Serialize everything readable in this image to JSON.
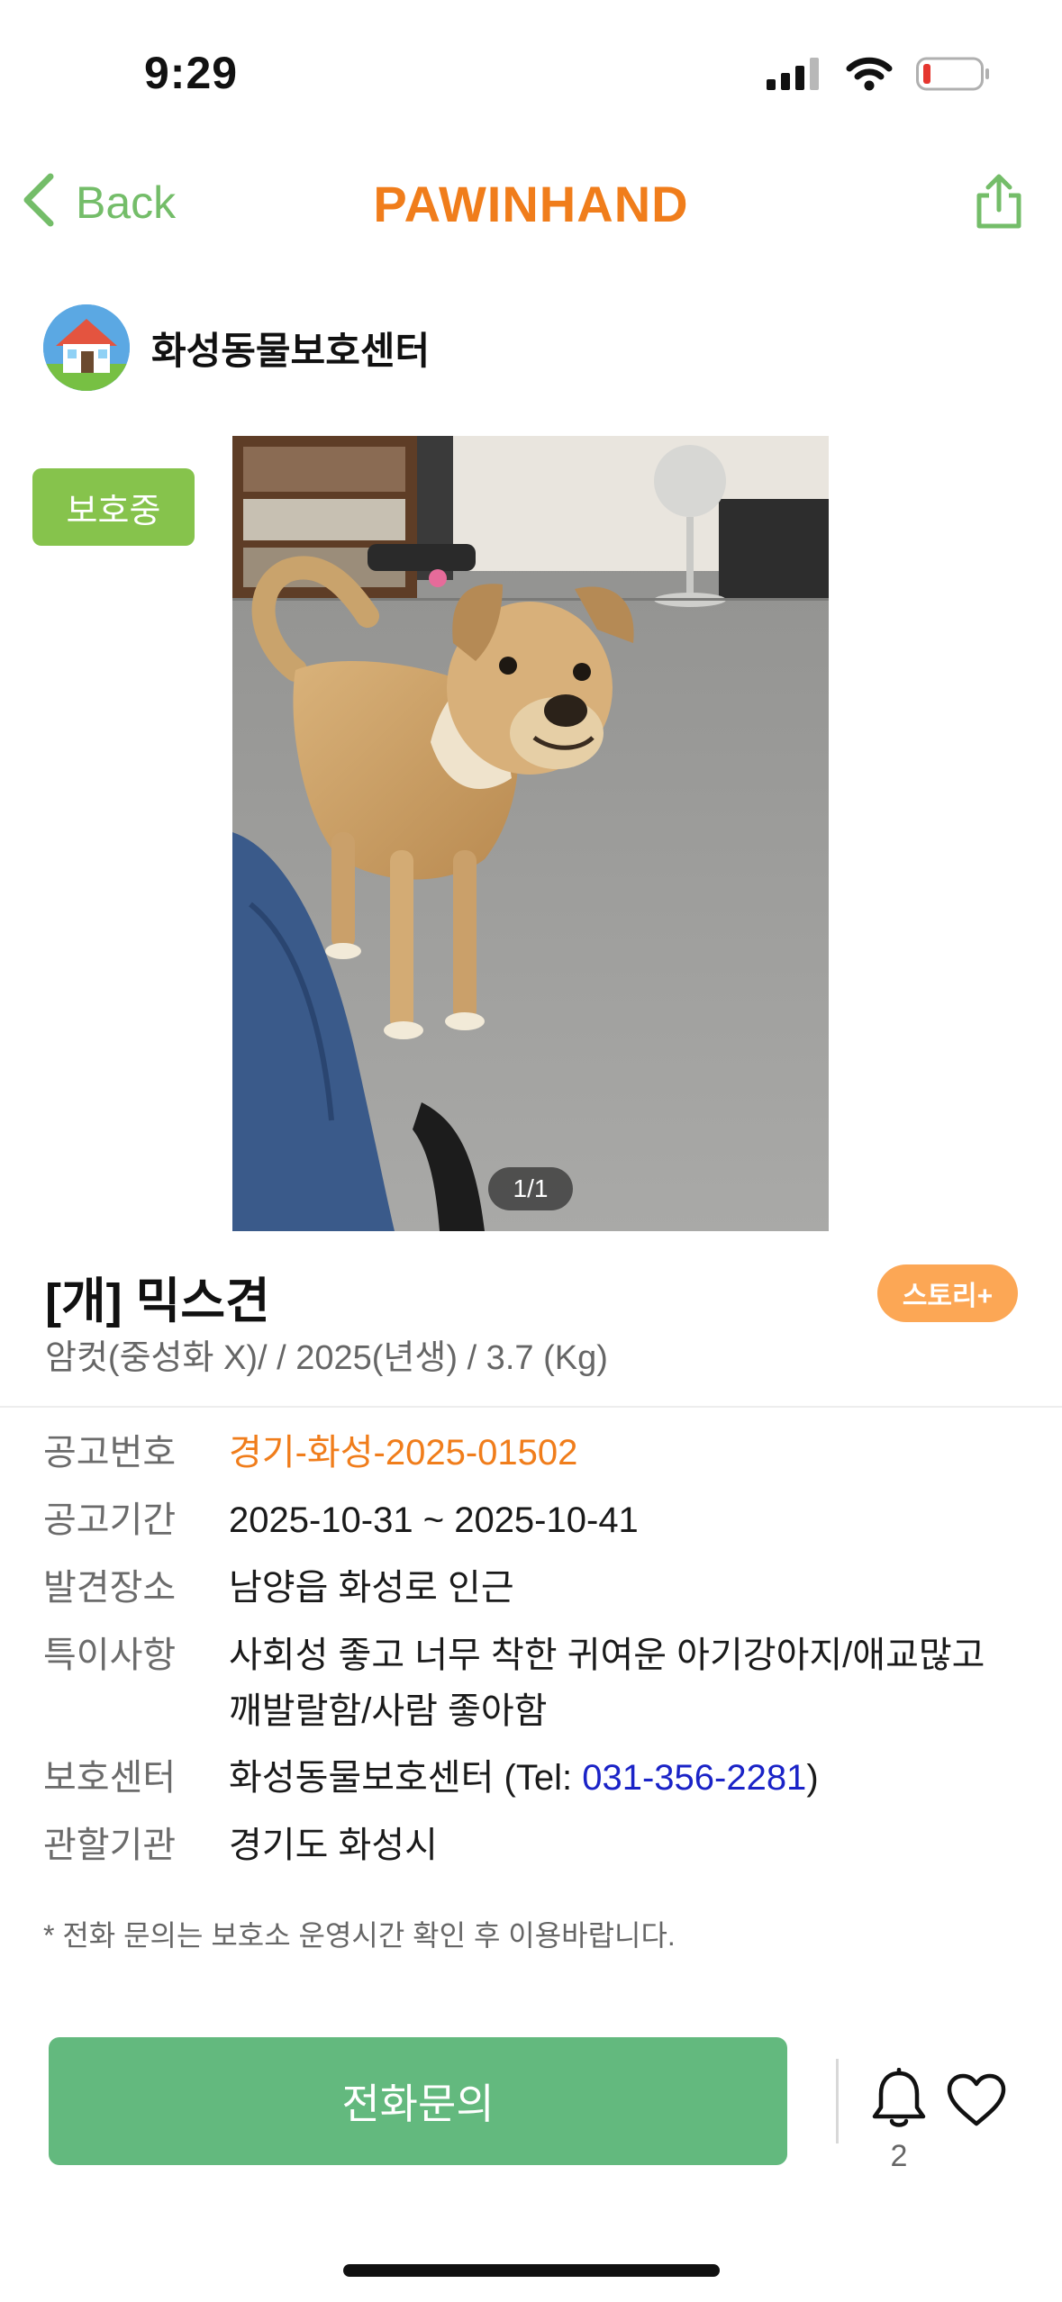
{
  "status_bar": {
    "time": "9:29"
  },
  "nav": {
    "back_label": "Back",
    "app_title": "PAWINHAND"
  },
  "shelter": {
    "name": "화성동물보호센터"
  },
  "status_badge": "보호중",
  "photo": {
    "counter": "1/1"
  },
  "animal": {
    "title": "[개] 믹스견",
    "subtitle": "암컷(중성화 X)/ / 2025(년생) /  3.7 (Kg)",
    "story_label": "스토리+"
  },
  "details": {
    "notice_no": {
      "label": "공고번호",
      "value": "경기-화성-2025-01502"
    },
    "notice_period": {
      "label": "공고기간",
      "value": "2025-10-31 ~ 2025-10-41"
    },
    "found_place": {
      "label": "발견장소",
      "value": "남양읍 화성로 인근"
    },
    "features": {
      "label": "특이사항",
      "line1": "사회성 좋고 너무 착한 귀여운 아기강아지/애교많고",
      "line2": "깨발랄함/사람 좋아함"
    },
    "center": {
      "label": "보호센터",
      "name": "화성동물보호센터",
      "tel_prefix": " (Tel: ",
      "phone": "031-356-2281",
      "tel_suffix": ")"
    },
    "authority": {
      "label": "관할기관",
      "value": "경기도 화성시"
    }
  },
  "notice_text": "* 전화 문의는 보호소 운영시간 확인 후 이용바랍니다.",
  "bottom": {
    "call_label": "전화문의",
    "bell_count": "2"
  },
  "colors": {
    "accent_orange": "#f07d1b",
    "green": "#63b97e",
    "badge_green": "#86c34c",
    "story_orange": "#fca755",
    "link_blue": "#1a23c7"
  },
  "icons": [
    "signal-icon",
    "wifi-icon",
    "battery-icon",
    "chevron-left-icon",
    "share-icon",
    "house-icon",
    "bell-icon",
    "heart-icon"
  ]
}
